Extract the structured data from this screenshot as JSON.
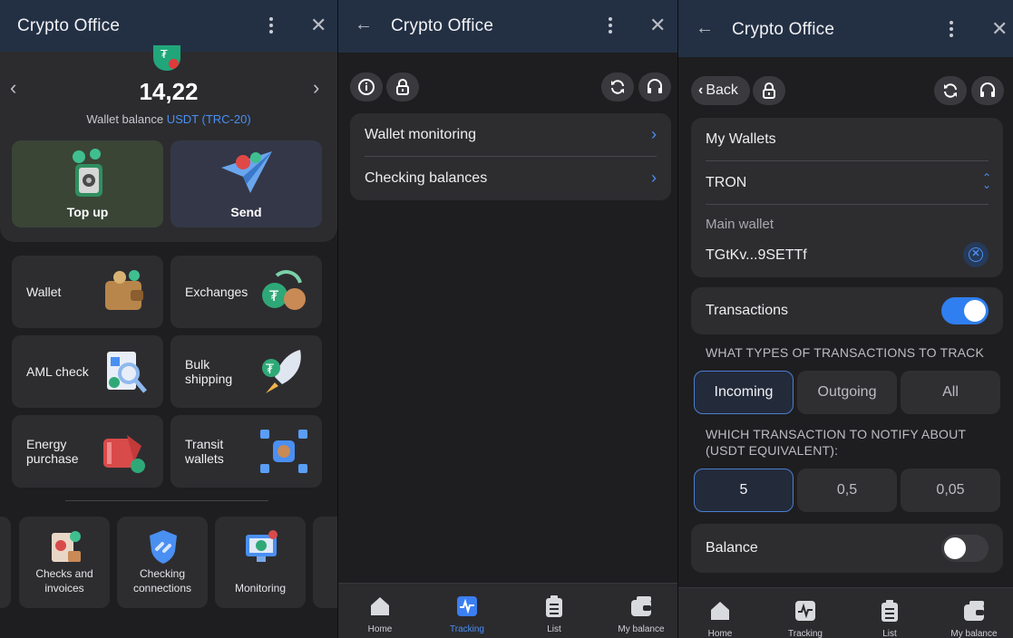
{
  "app_title": "Crypto Office",
  "screen1": {
    "balance": {
      "amount": "14,22",
      "label": "Wallet balance",
      "currency": "USDT (TRC-20)"
    },
    "actions": [
      {
        "label": "Top up"
      },
      {
        "label": "Send"
      }
    ],
    "grid": [
      {
        "label": "Wallet",
        "icon": "wallet-icon"
      },
      {
        "label": "Exchanges",
        "icon": "exchange-icon"
      },
      {
        "label": "AML check",
        "icon": "aml-check-icon"
      },
      {
        "label": "Bulk shipping",
        "icon": "rocket-icon"
      },
      {
        "label": "Energy purchase",
        "icon": "energy-icon"
      },
      {
        "label": "Transit wallets",
        "icon": "network-icon"
      }
    ],
    "services": [
      {
        "label": "Checks and invoices",
        "icon": "invoice-icon"
      },
      {
        "label": "Checking connections",
        "icon": "shield-link-icon"
      },
      {
        "label": "Monitoring",
        "icon": "monitor-icon"
      }
    ]
  },
  "screen2": {
    "menu": [
      {
        "label": "Wallet monitoring"
      },
      {
        "label": "Checking balances"
      }
    ]
  },
  "screen3": {
    "back_label": "Back",
    "wallets_title": "My Wallets",
    "network": "TRON",
    "wallet_name": "Main wallet",
    "wallet_address": "TGtKv...9SETTf",
    "transactions_label": "Transactions",
    "transactions_enabled": true,
    "types_caption": "WHAT TYPES OF TRANSACTIONS TO TRACK",
    "types": [
      "Incoming",
      "Outgoing",
      "All"
    ],
    "types_selected": "Incoming",
    "notify_caption_1": "WHICH TRANSACTION TO NOTIFY ABOUT",
    "notify_caption_2": "(USDT EQUIVALENT):",
    "thresholds": [
      "5",
      "0,5",
      "0,05"
    ],
    "threshold_selected": "5",
    "balance_label": "Balance",
    "balance_enabled": false
  },
  "tabbar": {
    "tabs": [
      {
        "label": "Home",
        "icon": "home-icon"
      },
      {
        "label": "Tracking",
        "icon": "tracking-icon"
      },
      {
        "label": "List",
        "icon": "clipboard-list-icon"
      },
      {
        "label": "My balance",
        "icon": "wallet-tab-icon"
      }
    ],
    "active_tab_screen2": "Tracking"
  },
  "colors": {
    "header_bg": "#233044",
    "accent": "#4a8ff2",
    "toggle_on": "#2f7ff0",
    "topup_bg": "#3a4536",
    "send_bg": "#343748"
  }
}
